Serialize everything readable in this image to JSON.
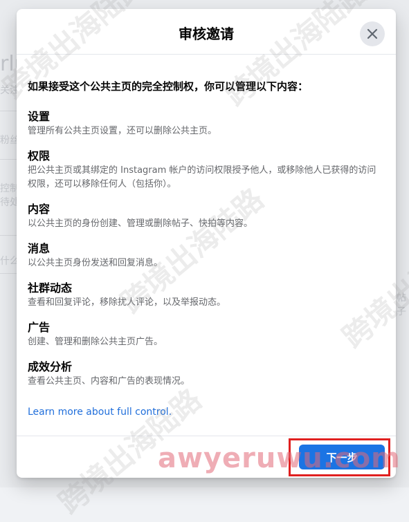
{
  "background": {
    "fragments": [
      "rlu",
      "关注",
      "粉丝",
      "控制",
      "待处",
      "什么",
      "帖子"
    ]
  },
  "dialog": {
    "title": "审核邀请",
    "lead": "如果接受这个公共主页的完全控制权，你可以管理以下内容：",
    "sections": [
      {
        "title": "设置",
        "desc": "管理所有公共主页设置，还可以删除公共主页。"
      },
      {
        "title": "权限",
        "desc": "把公共主页或其绑定的 Instagram 帐户的访问权限授予他人，或移除他人已获得的访问权限，还可以移除任何人（包括你）。"
      },
      {
        "title": "内容",
        "desc": "以公共主页的身份创建、管理或删除帖子、快拍等内容。"
      },
      {
        "title": "消息",
        "desc": "以公共主页身份发送和回复消息。"
      },
      {
        "title": "社群动态",
        "desc": "查看和回复评论，移除扰人评论，以及举报动态。"
      },
      {
        "title": "广告",
        "desc": "创建、管理和删除公共主页广告。"
      },
      {
        "title": "成效分析",
        "desc": "查看公共主页、内容和广告的表现情况。"
      }
    ],
    "learn_more": "Learn more about full control.",
    "next_button": "下一步",
    "close_icon": "close-icon"
  },
  "watermarks": {
    "text": "跨境出海陆路",
    "url": "awyeruwu.com"
  },
  "colors": {
    "primary": "#1b74e4",
    "link": "#216fdb",
    "highlight": "#e02020"
  }
}
